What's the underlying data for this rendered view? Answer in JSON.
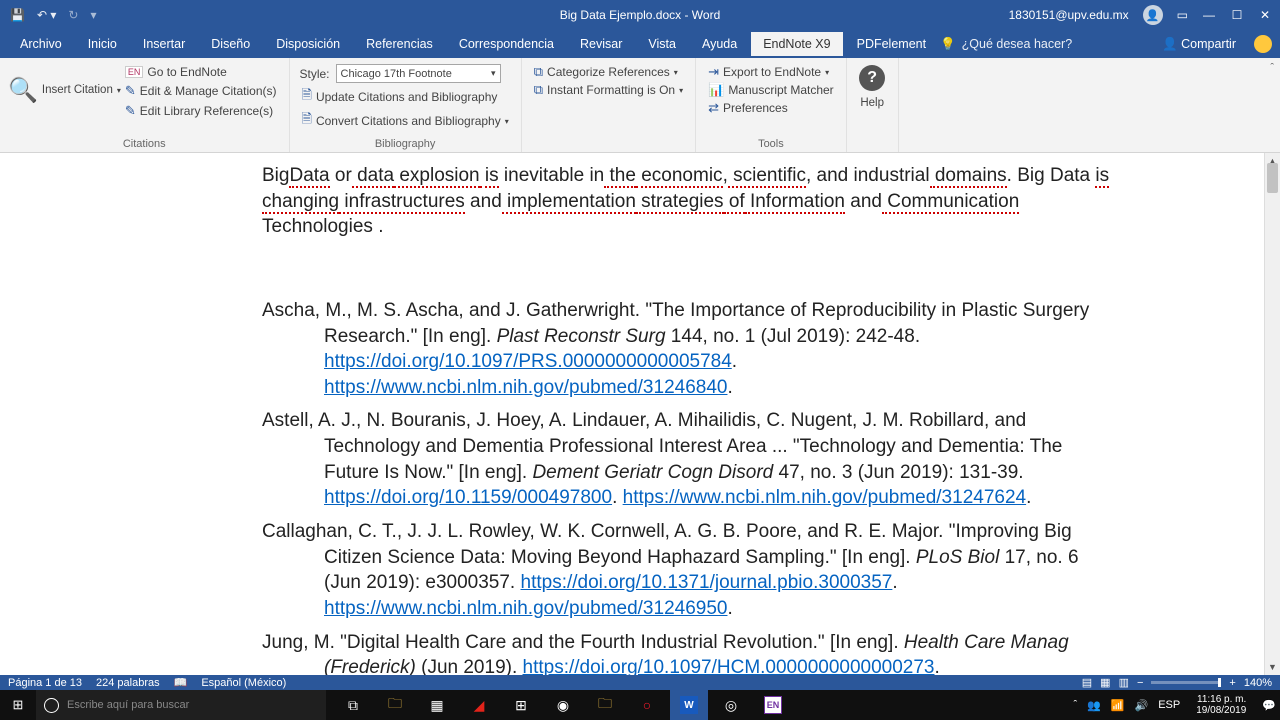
{
  "titlebar": {
    "doc_title": "Big Data Ejemplo.docx - Word",
    "user_email": "1830151@upv.edu.mx"
  },
  "menu": {
    "tabs": [
      "Archivo",
      "Inicio",
      "Insertar",
      "Diseño",
      "Disposición",
      "Referencias",
      "Correspondencia",
      "Revisar",
      "Vista",
      "Ayuda",
      "EndNote X9",
      "PDFelement"
    ],
    "active": "EndNote X9",
    "tell_me": "¿Qué desea hacer?",
    "share": "Compartir"
  },
  "ribbon": {
    "insert_citation": "Insert\nCitation",
    "go_to_endnote": "Go to EndNote",
    "edit_manage": "Edit & Manage Citation(s)",
    "edit_library": "Edit Library Reference(s)",
    "citations_label": "Citations",
    "style_label": "Style:",
    "style_value": "Chicago 17th Footnote",
    "update_citations": "Update Citations and Bibliography",
    "convert_citations": "Convert Citations and Bibliography",
    "bibliography_label": "Bibliography",
    "categorize": "Categorize References",
    "instant_formatting": "Instant Formatting is On",
    "export_endnote": "Export to EndNote",
    "manuscript_matcher": "Manuscript Matcher",
    "preferences": "Preferences",
    "tools_label": "Tools",
    "help": "Help"
  },
  "document": {
    "intro_parts": {
      "p1": "Big",
      "sp1": "Data",
      "p2": " or",
      "sp2": " data",
      "sp3": " explosion",
      "sp4": " is",
      "p3": " inevitable in",
      "sp5": " the",
      "sp6": " economic",
      "p4": ",",
      "sp7": " scientific",
      "p5": ", and industrial",
      "sp8": " domains",
      "p6": ". Big Data",
      "sp9": "is",
      "sp10": " changing",
      "sp11": " infrastructures",
      "p7": " and",
      "sp12": " implementation",
      "sp13": " strategies",
      "sp14": " of",
      "sp15": " Information",
      "p8": " and",
      "sp16": " Communication",
      "p9": "Technologies ."
    },
    "refs": [
      {
        "text1": "Ascha, M., M. S. Ascha, and J. Gatherwright. \"The Importance of Reproducibility in Plastic Surgery Research.\" [In eng]. ",
        "italic1": "Plast Reconstr Surg",
        "text2": " 144, no. 1 (Jul 2019): 242-48. ",
        "link1": "https://doi.org/10.1097/PRS.0000000000005784",
        "text3": ". ",
        "link2": "https://www.ncbi.nlm.nih.gov/pubmed/31246840",
        "text4": "."
      },
      {
        "text1": "Astell, A. J., N. Bouranis, J. Hoey, A. Lindauer, A. Mihailidis, C. Nugent, J. M. Robillard, and Technology and Dementia Professional Interest Area ... \"Technology and Dementia: The Future Is Now.\" [In eng]. ",
        "italic1": "Dement Geriatr Cogn Disord",
        "text2": " 47, no. 3 (Jun 2019): 131-39. ",
        "link1": "https://doi.org/10.1159/000497800",
        "text3": ". ",
        "link2": "https://www.ncbi.nlm.nih.gov/pubmed/31247624",
        "text4": "."
      },
      {
        "text1": "Callaghan, C. T., J. J. L. Rowley, W. K. Cornwell, A. G. B. Poore, and R. E. Major. \"Improving Big Citizen Science Data: Moving Beyond Haphazard Sampling.\" [In eng]. ",
        "italic1": "PLoS Biol",
        "text2": " 17, no. 6 (Jun 2019): e3000357. ",
        "link1": "https://doi.org/10.1371/journal.pbio.3000357",
        "text3": ". ",
        "link2": "https://www.ncbi.nlm.nih.gov/pubmed/31246950",
        "text4": "."
      },
      {
        "text1": "Jung, M. \"Digital Health Care and the Fourth Industrial Revolution.\" [In eng]. ",
        "italic1": "Health Care Manag (Frederick)",
        "text2": "  (Jun 2019). ",
        "link1": "https://doi.org/10.1097/HCM.0000000000000273",
        "text3": ".",
        "link2": "",
        "text4": ""
      }
    ]
  },
  "statusbar": {
    "page": "Página 1 de 13",
    "words": "224 palabras",
    "language": "Español (México)",
    "zoom": "140%"
  },
  "taskbar": {
    "search_placeholder": "Escribe aquí para buscar",
    "lang": "ESP",
    "time": "11:16 p. m.",
    "date": "19/08/2019"
  }
}
